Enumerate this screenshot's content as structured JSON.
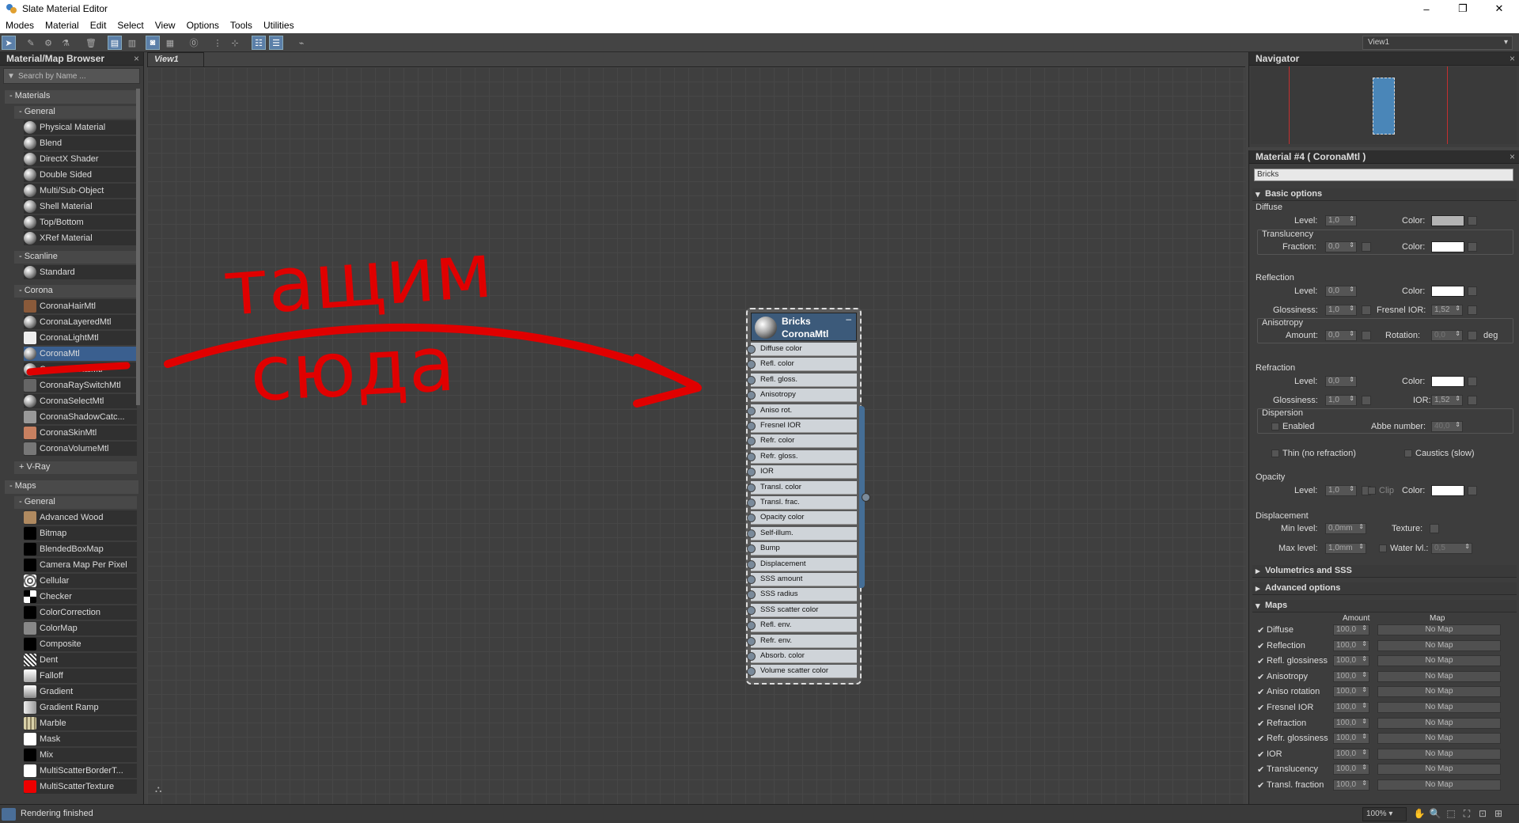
{
  "window": {
    "title": "Slate Material Editor",
    "minimize": "–",
    "maximize": "❐",
    "close": "✕"
  },
  "menu": [
    "Modes",
    "Material",
    "Edit",
    "Select",
    "View",
    "Options",
    "Tools",
    "Utilities"
  ],
  "toolbar": {
    "view_select": "View1"
  },
  "browser": {
    "title": "Material/Map Browser",
    "search_placeholder": "Search by Name ...",
    "materials_label": "- Materials",
    "general_label": "- General",
    "general_items": [
      "Physical Material",
      "Blend",
      "DirectX Shader",
      "Double Sided",
      "Multi/Sub-Object",
      "Shell Material",
      "Top/Bottom",
      "XRef Material"
    ],
    "scanline_label": "- Scanline",
    "scanline_items": [
      "Standard"
    ],
    "corona_label": "- Corona",
    "corona_items": [
      "CoronaHairMtl",
      "CoronaLayeredMtl",
      "CoronaLightMtl",
      "CoronaMtl",
      "CoronaPortalMtl",
      "CoronaRaySwitchMtl",
      "CoronaSelectMtl",
      "CoronaShadowCatc...",
      "CoronaSkinMtl",
      "CoronaVolumeMtl"
    ],
    "vray_label": "+ V-Ray",
    "maps_label": "- Maps",
    "maps_general_label": "- General",
    "map_items": [
      "Advanced Wood",
      "Bitmap",
      "BlendedBoxMap",
      "Camera Map Per Pixel",
      "Cellular",
      "Checker",
      "ColorCorrection",
      "ColorMap",
      "Composite",
      "Dent",
      "Falloff",
      "Gradient",
      "Gradient Ramp",
      "Marble",
      "Mask",
      "Mix",
      "MultiScatterBorderT...",
      "MultiScatterTexture"
    ]
  },
  "view": {
    "tab": "View1"
  },
  "node": {
    "name": "Bricks",
    "type": "CoronaMtl",
    "slots": [
      "Diffuse color",
      "Refl. color",
      "Refl. gloss.",
      "Anisotropy",
      "Aniso rot.",
      "Fresnel IOR",
      "Refr. color",
      "Refr. gloss.",
      "IOR",
      "Transl. color",
      "Transl. frac.",
      "Opacity color",
      "Self-illum.",
      "Bump",
      "Displacement",
      "SSS amount",
      "SSS radius",
      "SSS scatter color",
      "Refl. env.",
      "Refr. env.",
      "Absorb. color",
      "Volume scatter color"
    ]
  },
  "annotation": {
    "line1": "тащим",
    "line2": "сюда",
    "color": "#e00000"
  },
  "navigator": {
    "title": "Navigator"
  },
  "material_panel": {
    "title": "Material #4  ( CoronaMtl )",
    "name_value": "Bricks",
    "basic_options": "Basic options",
    "diffuse": "Diffuse",
    "level": "Level:",
    "color": "Color:",
    "diffuse_level": "1,0",
    "translucency": "Translucency",
    "fraction": "Fraction:",
    "fraction_value": "0,0",
    "reflection": "Reflection",
    "refl_level": "0,0",
    "glossiness": "Glossiness:",
    "refl_gloss": "1,0",
    "fresnel_ior": "Fresnel IOR:",
    "fresnel_value": "1,52",
    "anisotropy": "Anisotropy",
    "amount": "Amount:",
    "amount_value": "0,0",
    "rotation": "Rotation:",
    "rotation_value": "0,0",
    "deg": "deg",
    "refraction": "Refraction",
    "refr_level": "0,0",
    "refr_gloss": "1,0",
    "ior": "IOR:",
    "ior_value": "1,52",
    "dispersion": "Dispersion",
    "enabled": "Enabled",
    "abbe": "Abbe number:",
    "abbe_value": "40,0",
    "thin": "Thin (no refraction)",
    "caustics": "Caustics (slow)",
    "opacity": "Opacity",
    "opacity_level": "1,0",
    "clip": "Clip",
    "displacement": "Displacement",
    "min_level": "Min level:",
    "min_value": "0,0mm",
    "texture": "Texture:",
    "max_level": "Max level:",
    "max_value": "1,0mm",
    "water": "Water lvl.:",
    "water_value": "0,5",
    "volumetrics": "Volumetrics and SSS",
    "advanced": "Advanced options",
    "maps": "Maps",
    "amount_hdr": "Amount",
    "map_hdr": "Map",
    "map_rows": [
      {
        "name": "Diffuse",
        "amount": "100,0",
        "map": "No Map"
      },
      {
        "name": "Reflection",
        "amount": "100,0",
        "map": "No Map"
      },
      {
        "name": "Refl. glossiness",
        "amount": "100,0",
        "map": "No Map"
      },
      {
        "name": "Anisotropy",
        "amount": "100,0",
        "map": "No Map"
      },
      {
        "name": "Aniso rotation",
        "amount": "100,0",
        "map": "No Map"
      },
      {
        "name": "Fresnel IOR",
        "amount": "100,0",
        "map": "No Map"
      },
      {
        "name": "Refraction",
        "amount": "100,0",
        "map": "No Map"
      },
      {
        "name": "Refr. glossiness",
        "amount": "100,0",
        "map": "No Map"
      },
      {
        "name": "IOR",
        "amount": "100,0",
        "map": "No Map"
      },
      {
        "name": "Translucency",
        "amount": "100,0",
        "map": "No Map"
      },
      {
        "name": "Transl. fraction",
        "amount": "100,0",
        "map": "No Map"
      }
    ]
  },
  "status": {
    "text": "Rendering finished",
    "zoom": "100%"
  }
}
